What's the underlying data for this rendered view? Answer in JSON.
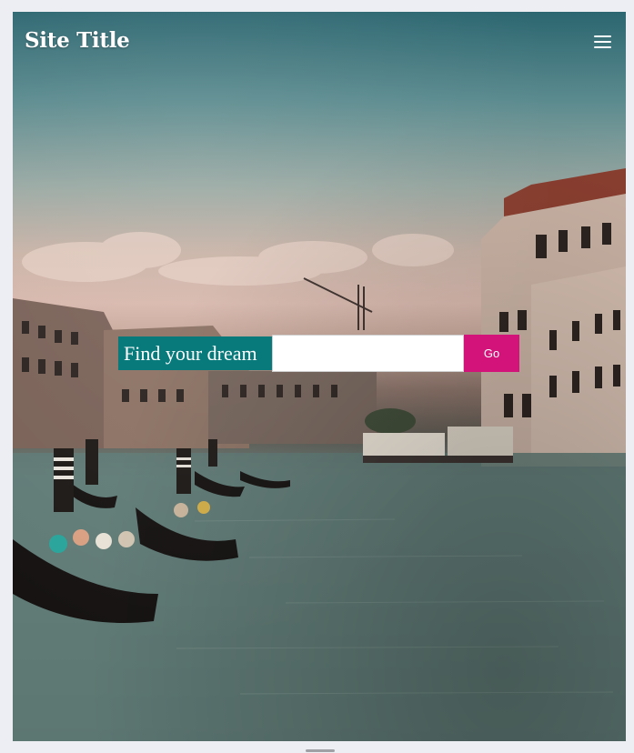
{
  "header": {
    "site_title": "Site Title",
    "menu_icon": "hamburger-menu-icon"
  },
  "hero": {
    "image_subject": "venice-grand-canal-photo",
    "search": {
      "label": "Find your dream",
      "input_value": "",
      "button_label": "Go"
    }
  },
  "colors": {
    "label_bg": "#087a7c",
    "button_bg": "#d4137a",
    "page_bg": "#eceef3"
  }
}
